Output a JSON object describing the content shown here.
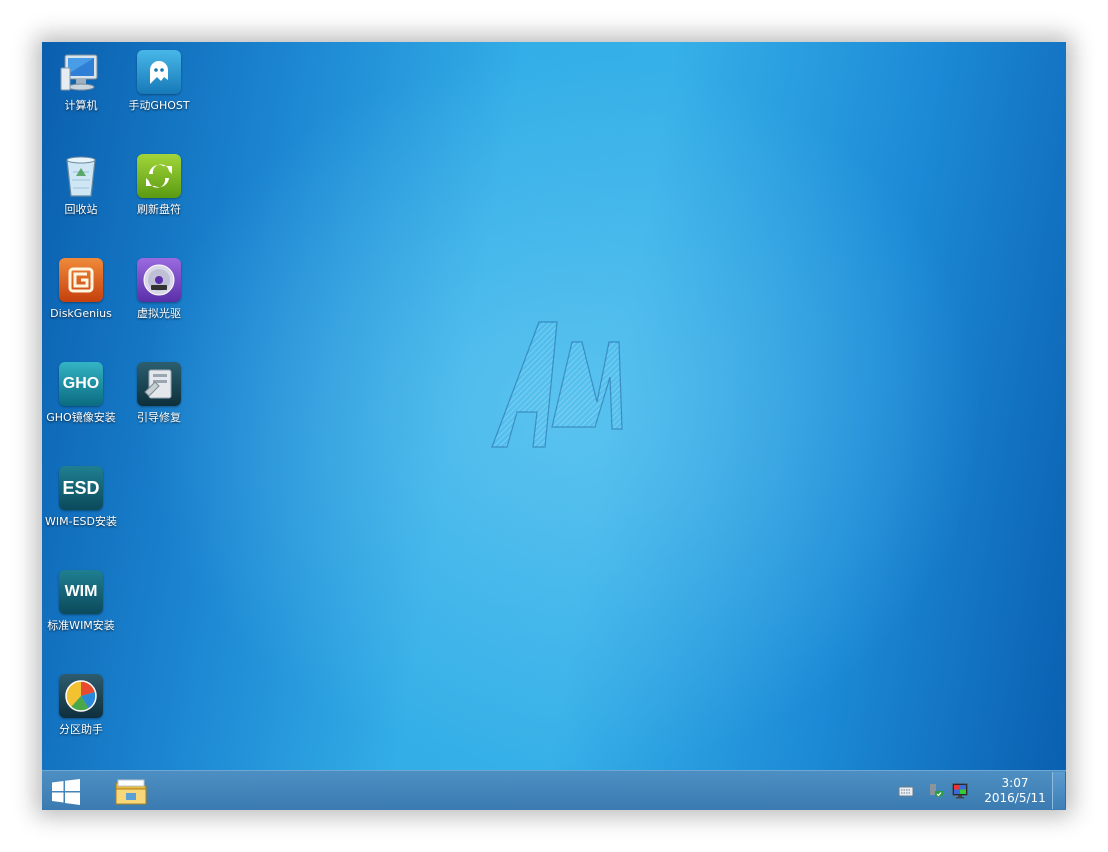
{
  "desktop": {
    "icons": [
      {
        "label": "计算机",
        "icon": "computer-icon"
      },
      {
        "label": "手动GHOST",
        "icon": "ghost-icon"
      },
      {
        "label": "回收站",
        "icon": "recycle-bin-icon"
      },
      {
        "label": "刷新盘符",
        "icon": "refresh-icon"
      },
      {
        "label": "DiskGenius",
        "icon": "diskgenius-icon"
      },
      {
        "label": "虚拟光驱",
        "icon": "dvd-icon"
      },
      {
        "label": "GHO镜像安装",
        "icon": "gho-icon",
        "badge": "GHO"
      },
      {
        "label": "引导修复",
        "icon": "boot-repair-icon"
      },
      {
        "label": "WIM-ESD安装",
        "icon": "esd-icon",
        "badge": "ESD"
      },
      {
        "label": "标准WIM安装",
        "icon": "wim-icon",
        "badge": "WIM"
      },
      {
        "label": "分区助手",
        "icon": "partition-assistant-icon"
      }
    ],
    "wallpaper_logo": "AM"
  },
  "taskbar": {
    "start_icon": "windows-logo-icon",
    "pinned": [
      {
        "icon": "file-explorer-icon"
      }
    ],
    "tray": [
      {
        "icon": "keyboard-icon"
      },
      {
        "icon": "security-shield-icon"
      },
      {
        "icon": "display-icon"
      }
    ],
    "clock": {
      "time": "3:07",
      "date": "2016/5/11"
    }
  },
  "colors": {
    "desktop_blue": "#1c86d2",
    "taskbar": "#4d8fc3"
  }
}
